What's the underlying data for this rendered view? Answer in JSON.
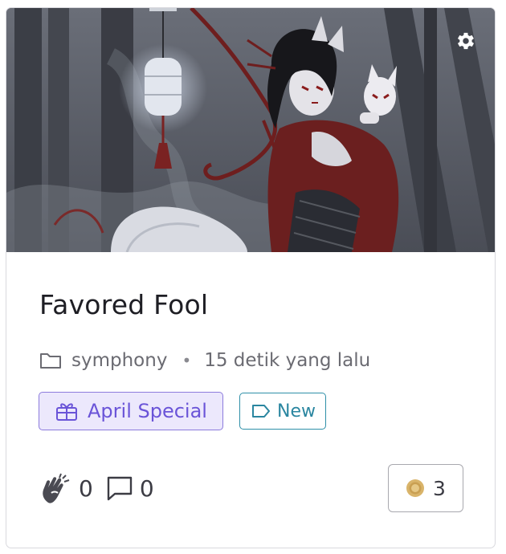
{
  "story": {
    "title": "Favored Fool",
    "author": "symphony",
    "timestamp": "15 detik yang lalu"
  },
  "tags": {
    "special_label": "April Special",
    "new_label": "New"
  },
  "stats": {
    "claps": "0",
    "comments": "0",
    "coins": "3"
  },
  "icons": {
    "settings": "gear-icon",
    "author": "folder-icon",
    "special": "gift-icon",
    "new": "tag-icon",
    "claps": "clap-icon",
    "comments": "comment-icon",
    "coins": "coin-icon"
  },
  "colors": {
    "special_accent": "#6a54d8",
    "special_bg": "#ece8fc",
    "new_accent": "#2a86a0",
    "coin": "#d9b46a"
  }
}
